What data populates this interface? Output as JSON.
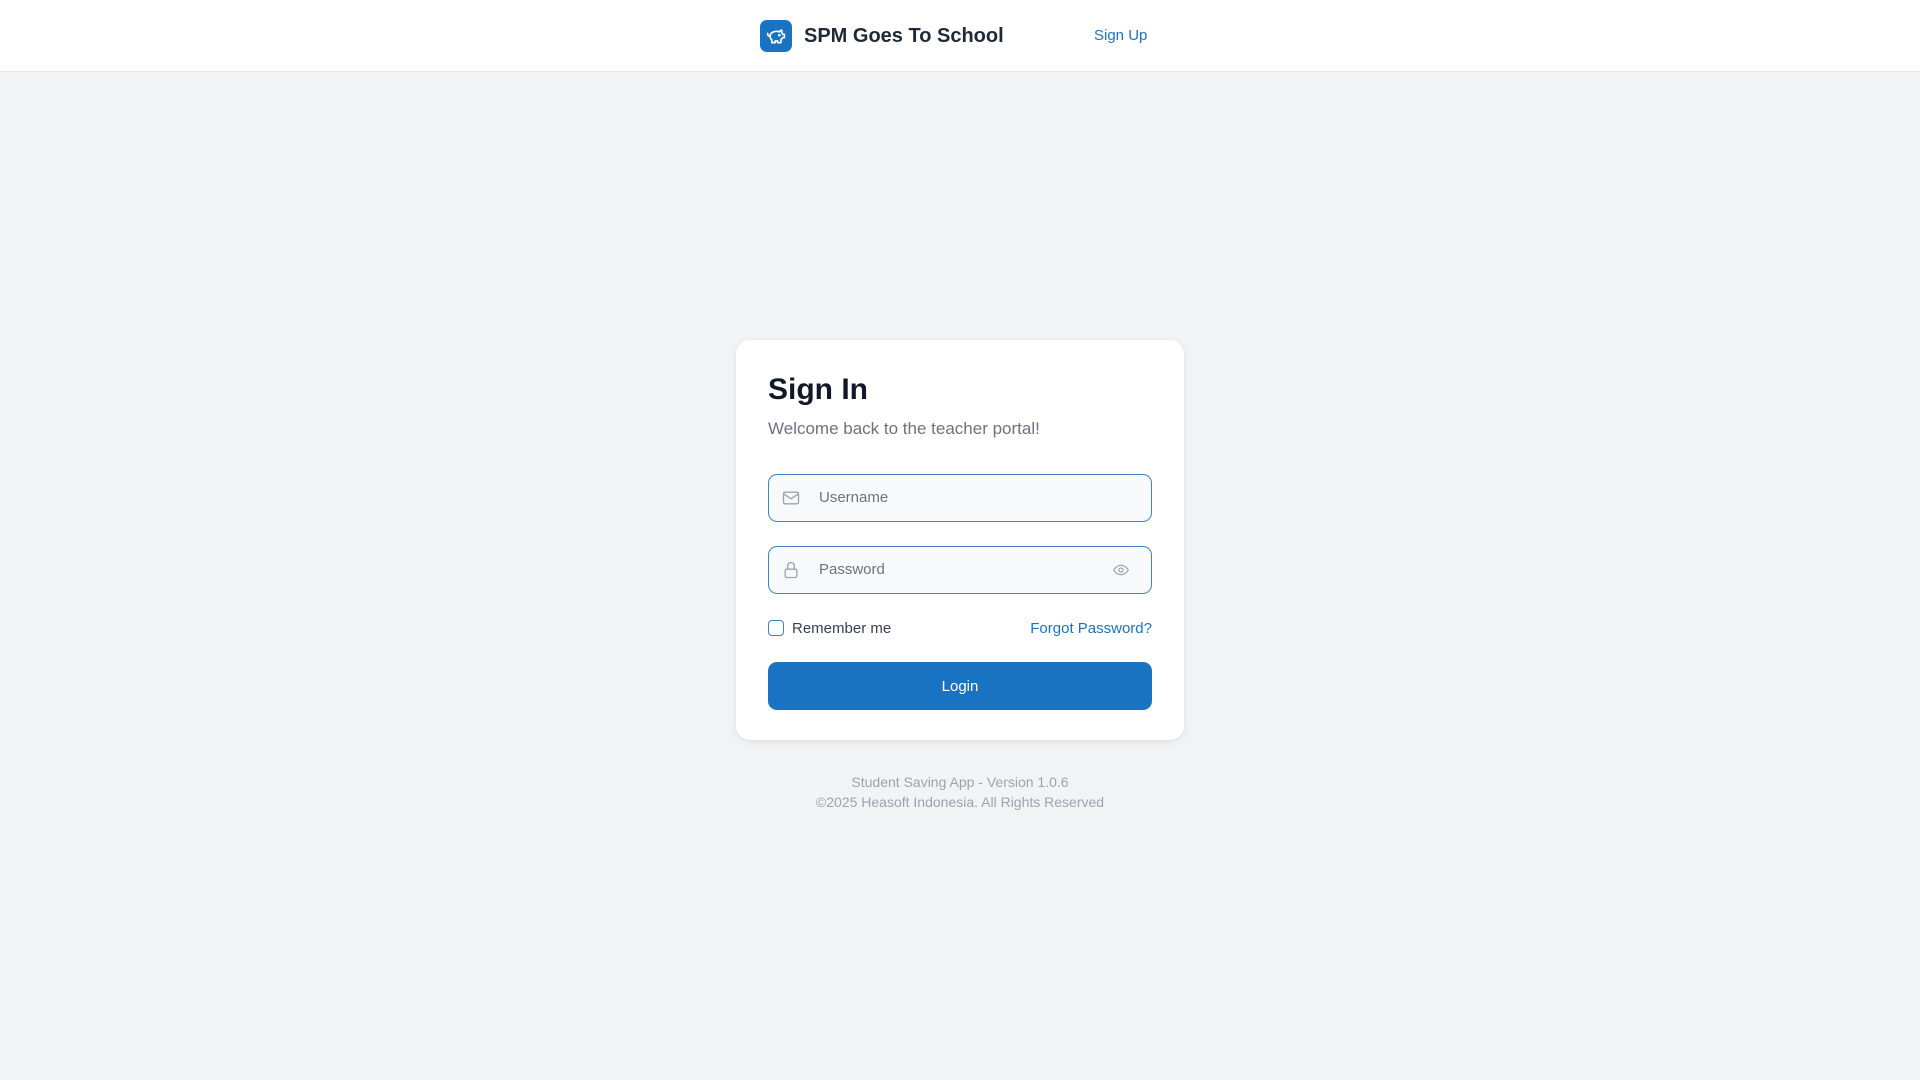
{
  "header": {
    "app_name": "SPM Goes To School",
    "logo_icon": "piggy-bank-icon",
    "signup_label": "Sign Up"
  },
  "login": {
    "title": "Sign In",
    "subtitle": "Welcome back to the teacher portal!",
    "username": {
      "placeholder": "Username",
      "value": "",
      "icon": "mail-icon"
    },
    "password": {
      "placeholder": "Password",
      "value": "",
      "icon": "lock-icon",
      "toggle_icon": "eye-icon"
    },
    "remember_label": "Remember me",
    "remember_checked": false,
    "forgot_label": "Forgot Password?",
    "login_label": "Login"
  },
  "footer": {
    "version_line": "Student Saving App - Version 1.0.6",
    "copyright_line": "©2025 Heasoft Indonesia. All Rights Reserved"
  },
  "colors": {
    "primary": "#1a73c2",
    "page_background": "#f2f3f5",
    "card_background": "#ffffff"
  }
}
